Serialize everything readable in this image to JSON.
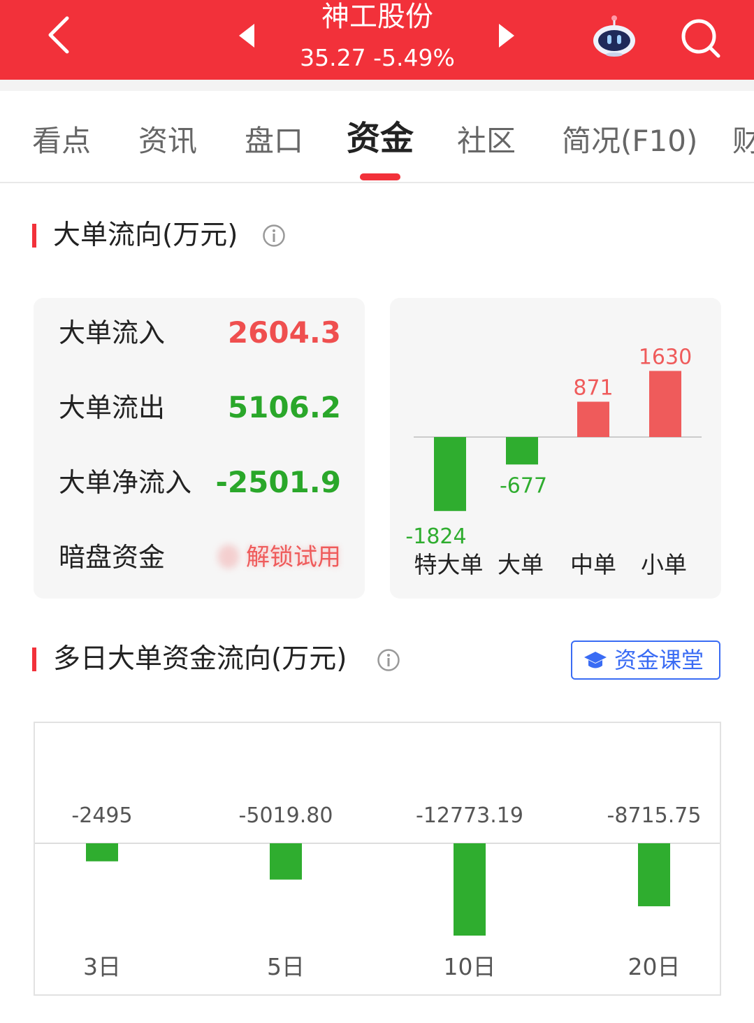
{
  "header": {
    "title": "神工股份",
    "quote": "35.27 -5.49%",
    "background_color": "#f2313a"
  },
  "tabs": [
    {
      "label": "看点",
      "active": false
    },
    {
      "label": "资讯",
      "active": false
    },
    {
      "label": "盘口",
      "active": false
    },
    {
      "label": "资金",
      "active": true
    },
    {
      "label": "社区",
      "active": false
    },
    {
      "label": "简况(F10)",
      "active": false
    },
    {
      "label": "财",
      "active": false
    }
  ],
  "big_order": {
    "heading": "大单流向(万元)",
    "rows": [
      {
        "label": "大单流入",
        "value": "2604.3",
        "color": "#ef4f4f"
      },
      {
        "label": "大单流出",
        "value": "5106.2",
        "color": "#2aa72a"
      },
      {
        "label": "大单净流入",
        "value": "-2501.9",
        "color": "#2aa72a"
      },
      {
        "label": "暗盘资金",
        "value": "解锁试用",
        "color": "#ef5b5b"
      }
    ]
  },
  "multi_day": {
    "heading": "多日大单资金流向(万元)",
    "course_button": "资金课堂"
  },
  "chart_data": [
    {
      "type": "bar",
      "categories": [
        "特大单",
        "大单",
        "中单",
        "小单"
      ],
      "values": [
        -1824,
        -677,
        871,
        1630
      ],
      "value_labels": [
        "-1824",
        "-677",
        "871",
        "1630"
      ],
      "title": "",
      "xlabel": "",
      "ylabel": "",
      "positive_color": "#ef5b5b",
      "negative_color": "#2fad2f",
      "grid": false
    },
    {
      "type": "bar",
      "categories": [
        "3日",
        "5日",
        "10日",
        "20日"
      ],
      "values": [
        -2495,
        -5019.8,
        -12773.19,
        -8715.75
      ],
      "value_labels": [
        "-2495",
        "-5019.80",
        "-12773.19",
        "-8715.75"
      ],
      "title": "",
      "xlabel": "",
      "ylabel": "",
      "negative_color": "#2fad2f",
      "grid": false
    }
  ]
}
